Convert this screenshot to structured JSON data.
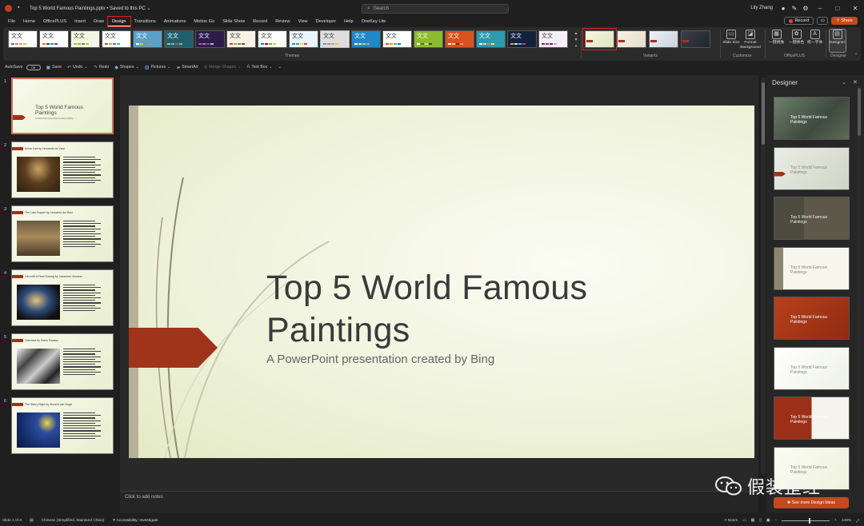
{
  "titlebar": {
    "autosave_label": "AutoSave",
    "file_title": "Top 5 World Famous Paintings.pptx • Saved to this PC ⌄",
    "search_placeholder": "Search",
    "user_name": "Lily Zhang"
  },
  "tabs": [
    "File",
    "Home",
    "OfficePLUS",
    "Insert",
    "Draw",
    "Design",
    "Transitions",
    "Animations",
    "Motion Go",
    "Slide Show",
    "Record",
    "Review",
    "View",
    "Developer",
    "Help",
    "OneKey Lite"
  ],
  "active_tab": "Design",
  "tab_actions": {
    "record": "Record",
    "share": "Share"
  },
  "ribbon": {
    "themes_label": "Themes",
    "theme_sample_text": "文文",
    "variants_label": "Variants",
    "customize_label": "Customize",
    "officeplus_label": "OfficePLUS",
    "designer_group_label": "Designer",
    "slide_size": "Slide Size",
    "format_background": "Format Background",
    "officeplus_btn1": "一键换肤",
    "officeplus_btn2": "一键换色",
    "officeplus_btn3": "统一字体",
    "designer_btn": "Designer"
  },
  "qat": {
    "autosave": "AutoSave",
    "autosave_state": "Off",
    "save": "Save",
    "undo": "Undo",
    "redo": "Redo",
    "shapes": "Shapes",
    "pictures": "Pictures",
    "smartart": "SmartArt",
    "merge_shapes": "Merge Shapes",
    "text_box": "Text Box"
  },
  "thumbnails": [
    {
      "num": "1",
      "title": "Top 5 World Famous Paintings",
      "subtitle": "A PowerPoint presentation created by Bing"
    },
    {
      "num": "2",
      "heading": "Mona Lisa by Leonardo da Vinci"
    },
    {
      "num": "3",
      "heading": "The Last Supper by Leonardo da Vinci"
    },
    {
      "num": "4",
      "heading": "Girl with a Pearl Earring by Johannes Vermeer"
    },
    {
      "num": "5",
      "heading": "Guernica by Pablo Picasso"
    },
    {
      "num": "6",
      "heading": "The Starry Night by Vincent van Gogh"
    }
  ],
  "slide": {
    "title_line1": "Top 5 World Famous",
    "title_line2": "Paintings",
    "subtitle": "A PowerPoint presentation created by Bing"
  },
  "notes_placeholder": "Click to add notes",
  "designer": {
    "header": "Designer",
    "idea_title": "Top 5 World Famous Paintings",
    "more_ideas": "See more Design Ideas"
  },
  "statusbar": {
    "slide_count": "Slide 1 of 6",
    "language": "Chinese (Simplified, Mainland China)",
    "accessibility": "Accessibility: Investigate",
    "notes": "Notes",
    "zoom": "149%"
  },
  "watermark": {
    "text": "假装歪经"
  },
  "colors": {
    "accent_orange": "#c4491f",
    "slide_arrow": "#a0341a",
    "highlight_red": "#e02020"
  }
}
